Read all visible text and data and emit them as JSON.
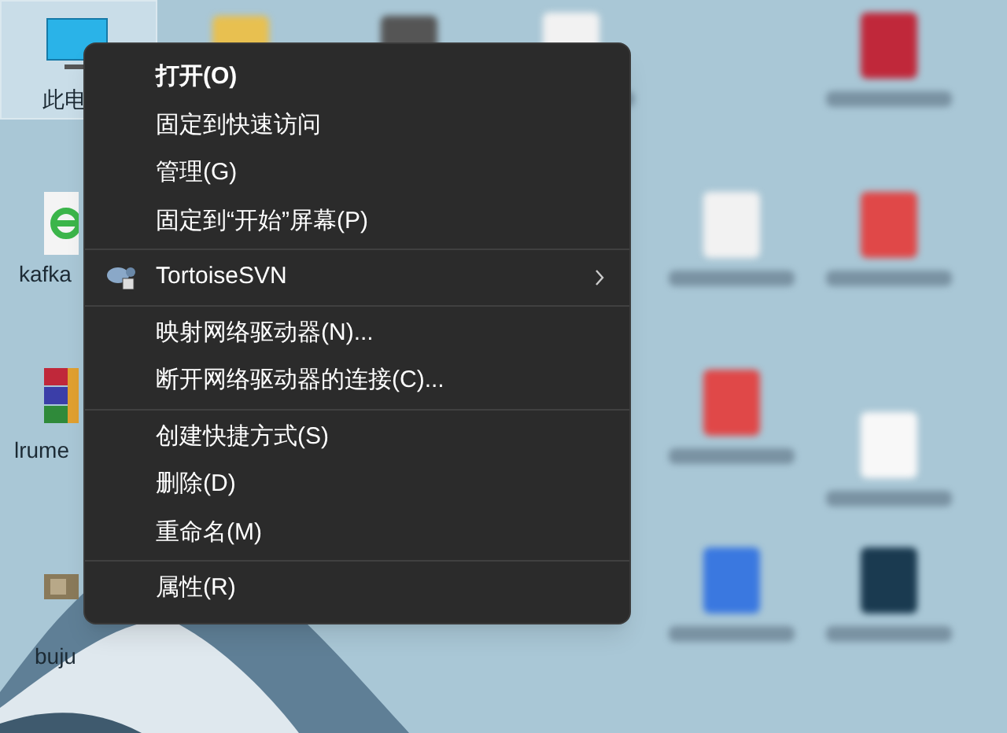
{
  "desktop": {
    "icons": [
      {
        "label": "此电",
        "kind": "monitor",
        "selected": true
      },
      {
        "label": "kafka",
        "kind": "browser",
        "selected": false
      },
      {
        "label": "lrume",
        "kind": "archive",
        "selected": false
      },
      {
        "label": "buju",
        "kind": "image",
        "selected": false
      }
    ]
  },
  "context_menu": {
    "groups": [
      [
        {
          "label": "打开(O)",
          "default": true
        },
        {
          "label": "固定到快速访问",
          "default": false
        },
        {
          "label": "管理(G)",
          "default": false
        },
        {
          "label": "固定到“开始”屏幕(P)",
          "default": false
        }
      ],
      [
        {
          "label": "TortoiseSVN",
          "default": false,
          "submenu": true,
          "kind": "svn"
        }
      ],
      [
        {
          "label": "映射网络驱动器(N)...",
          "default": false
        },
        {
          "label": "断开网络驱动器的连接(C)...",
          "default": false
        }
      ],
      [
        {
          "label": "创建快捷方式(S)",
          "default": false
        },
        {
          "label": "删除(D)",
          "default": false
        },
        {
          "label": "重命名(M)",
          "default": false
        }
      ],
      [
        {
          "label": "属性(R)",
          "default": false
        }
      ]
    ]
  }
}
